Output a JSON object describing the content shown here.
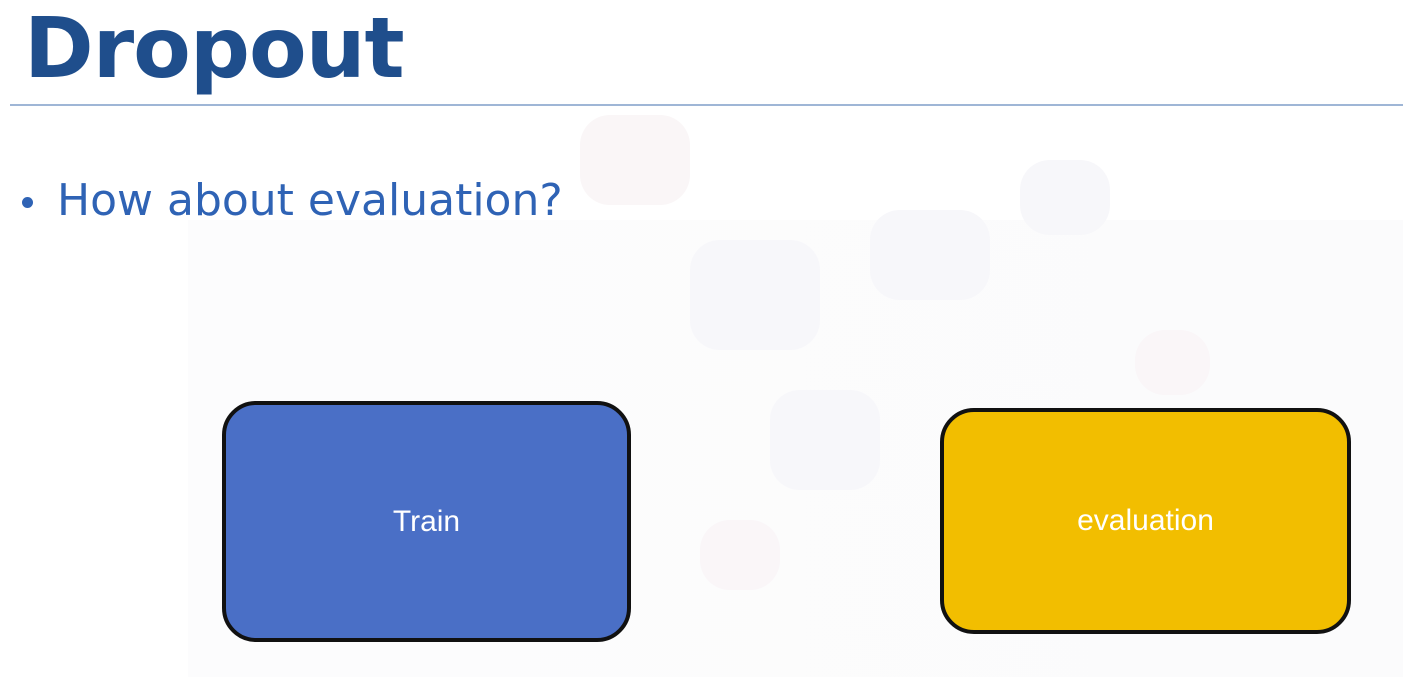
{
  "slide": {
    "title": "Dropout",
    "bullets": [
      {
        "text": "How about evaluation?"
      }
    ],
    "boxes": [
      {
        "label": "Train",
        "color": "#4a6fc6"
      },
      {
        "label": "evaluation",
        "color": "#f2be00"
      }
    ],
    "colors": {
      "title": "#1f4e8c",
      "bullet_text": "#2f63b5",
      "rule": "#9fb6d6",
      "box_border": "#111111"
    }
  }
}
